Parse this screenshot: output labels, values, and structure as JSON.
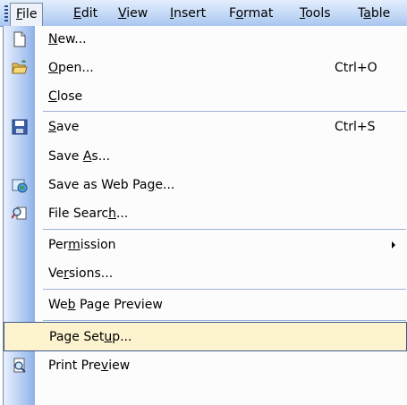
{
  "menubar": {
    "items": [
      {
        "pre": "",
        "key": "F",
        "post": "ile"
      },
      {
        "pre": "",
        "key": "E",
        "post": "dit"
      },
      {
        "pre": "",
        "key": "V",
        "post": "iew"
      },
      {
        "pre": "",
        "key": "I",
        "post": "nsert"
      },
      {
        "pre": "F",
        "key": "o",
        "post": "rmat"
      },
      {
        "pre": "",
        "key": "T",
        "post": "ools"
      },
      {
        "pre": "T",
        "key": "a",
        "post": "ble"
      }
    ]
  },
  "file_menu": {
    "items": [
      {
        "pre": "",
        "key": "N",
        "post": "ew...",
        "shortcut": "",
        "icon": "new-document-icon"
      },
      {
        "pre": "",
        "key": "O",
        "post": "pen...",
        "shortcut": "Ctrl+O",
        "icon": "open-folder-icon"
      },
      {
        "pre": "",
        "key": "C",
        "post": "lose",
        "shortcut": "",
        "icon": ""
      },
      {
        "pre": "",
        "key": "S",
        "post": "ave",
        "shortcut": "Ctrl+S",
        "icon": "save-disk-icon"
      },
      {
        "pre": "Save ",
        "key": "A",
        "post": "s...",
        "shortcut": "",
        "icon": ""
      },
      {
        "pre": "Save as Web Pa",
        "key": "g",
        "post": "e...",
        "shortcut": "",
        "icon": "web-page-icon"
      },
      {
        "pre": "File Searc",
        "key": "h",
        "post": "...",
        "shortcut": "",
        "icon": "file-search-icon"
      },
      {
        "pre": "Per",
        "key": "m",
        "post": "ission",
        "shortcut": "",
        "icon": ""
      },
      {
        "pre": "Ve",
        "key": "r",
        "post": "sions...",
        "shortcut": "",
        "icon": ""
      },
      {
        "pre": "We",
        "key": "b",
        "post": " Page Preview",
        "shortcut": "",
        "icon": ""
      },
      {
        "pre": "Page Set",
        "key": "u",
        "post": "p...",
        "shortcut": "",
        "icon": ""
      },
      {
        "pre": "Print Pre",
        "key": "v",
        "post": "iew",
        "shortcut": "",
        "icon": "print-preview-icon"
      }
    ],
    "highlighted_item": "Page Setup..."
  },
  "colors": {
    "menubar": "#c4d9f6",
    "gutter": "#b8cff4",
    "highlight_fill": "#fdf3cf",
    "highlight_border": "#3b5a8a"
  }
}
